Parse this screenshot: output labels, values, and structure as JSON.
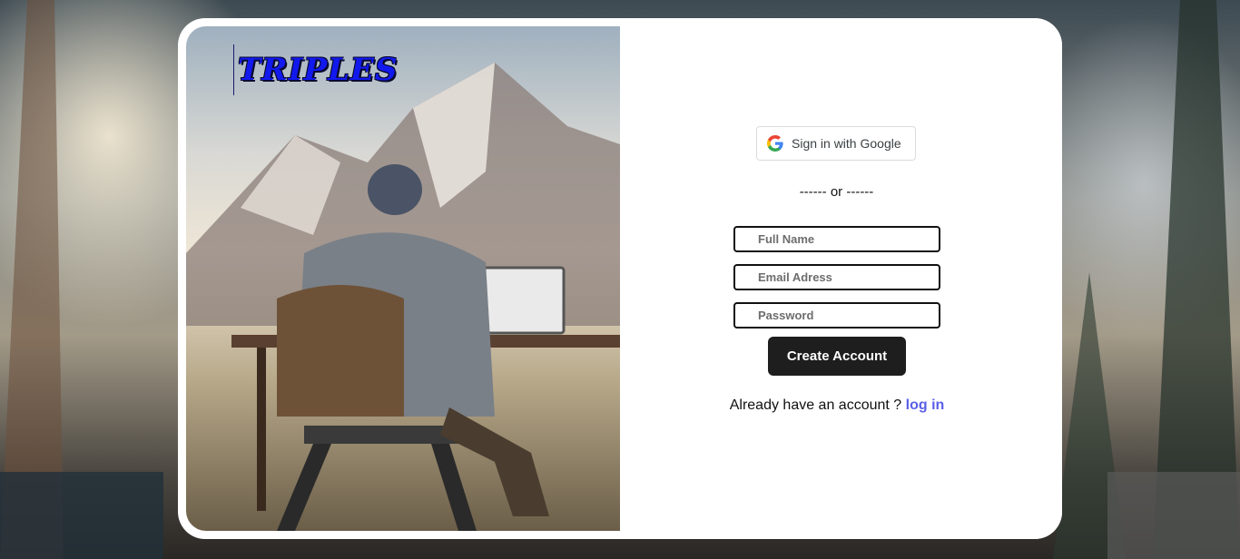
{
  "brand": {
    "logo_text": "TRIPLES"
  },
  "auth": {
    "google_button_label": "Sign in with Google",
    "divider_text": "------ or ------",
    "fields": {
      "full_name_placeholder": "Full Name",
      "email_placeholder": "Email Adress",
      "password_placeholder": "Password"
    },
    "create_account_label": "Create Account",
    "login_prompt": "Already have an account ? ",
    "login_link_label": "log in"
  },
  "icons": {
    "google": "google-g-icon"
  },
  "colors": {
    "brand_text": "#1219ee",
    "button_bg": "#1e1e1e",
    "link": "#5b5fe8"
  }
}
